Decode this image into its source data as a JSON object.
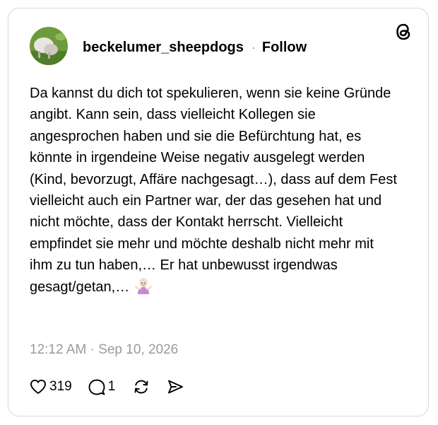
{
  "post": {
    "username": "beckelumer_sheepdogs",
    "separator": "·",
    "follow_label": "Follow",
    "text": "Da kannst du dich tot spekulieren, wenn sie keine Gründe angibt. Kann sein, dass vielleicht Kollegen sie angesprochen haben und sie die Befürchtung hat, es könnte in irgendeine Weise negativ ausgelegt werden (Kind, bevorzugt, Affäre nachgesagt…), dass auf dem Fest vielleicht auch ein Partner war, der das gesehen hat und nicht möchte, dass der Kontakt herrscht. Vielleicht empfindet sie mehr und möchte deshalb nicht mehr mit ihm zu tun haben,… Er hat unbewusst irgendwas gesagt/getan,…",
    "trailing_emoji": "person-shrugging-emoji",
    "timestamp": "12:12 AM · Sep 10, 2026",
    "likes": "319",
    "replies": "1"
  },
  "icons": {
    "logo": "threads-logo-icon",
    "like": "heart-icon",
    "reply": "comment-bubble-icon",
    "repost": "repost-icon",
    "share": "send-icon"
  },
  "colors": {
    "text": "#000000",
    "muted": "#9a9a9a",
    "border": "#d8d8d8",
    "emoji_shirt": "#c08ad8"
  }
}
